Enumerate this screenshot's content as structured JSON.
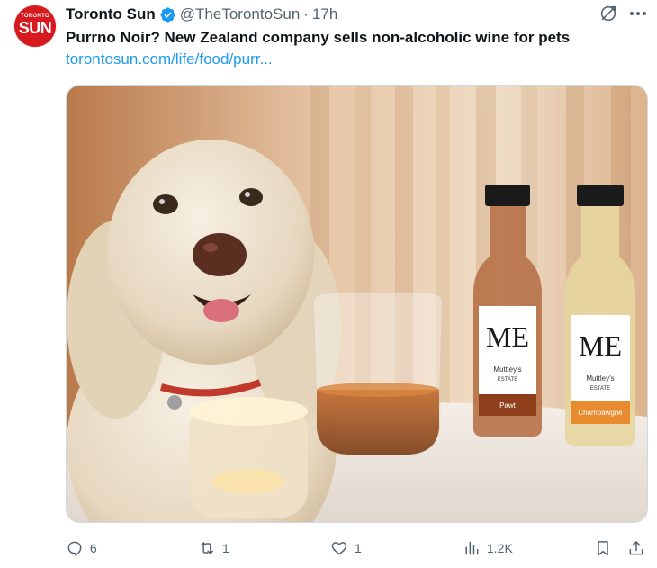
{
  "tweet": {
    "author": {
      "display_name": "Toronto Sun",
      "handle": "@TheTorontoSun",
      "avatar_small_text": "TORONTO",
      "avatar_big_text": "SUN",
      "verified": true
    },
    "separator": "·",
    "time": "17h",
    "text": "Purrno Noir? New Zealand company sells non-alcoholic wine for pets",
    "link": "torontosun.com/life/food/purr...",
    "media": {
      "bottle_brand": "Muttley's",
      "bottle_estate": "ESTATE",
      "bottle1_variety": "Pawt",
      "bottle2_variety": "Champawgne",
      "logo_letters": "ME"
    },
    "actions": {
      "replies": "6",
      "reposts": "1",
      "likes": "1",
      "views": "1.2K"
    },
    "icons": {
      "reply": "reply-icon",
      "repost": "repost-icon",
      "like": "heart-icon",
      "views": "views-icon",
      "bookmark": "bookmark-icon",
      "share": "share-icon",
      "grok": "grok-icon",
      "more": "more-icon",
      "verified": "verified-badge-icon"
    },
    "colors": {
      "accent": "#1d9bf0",
      "muted": "#536471",
      "brand": "#d71920"
    }
  }
}
